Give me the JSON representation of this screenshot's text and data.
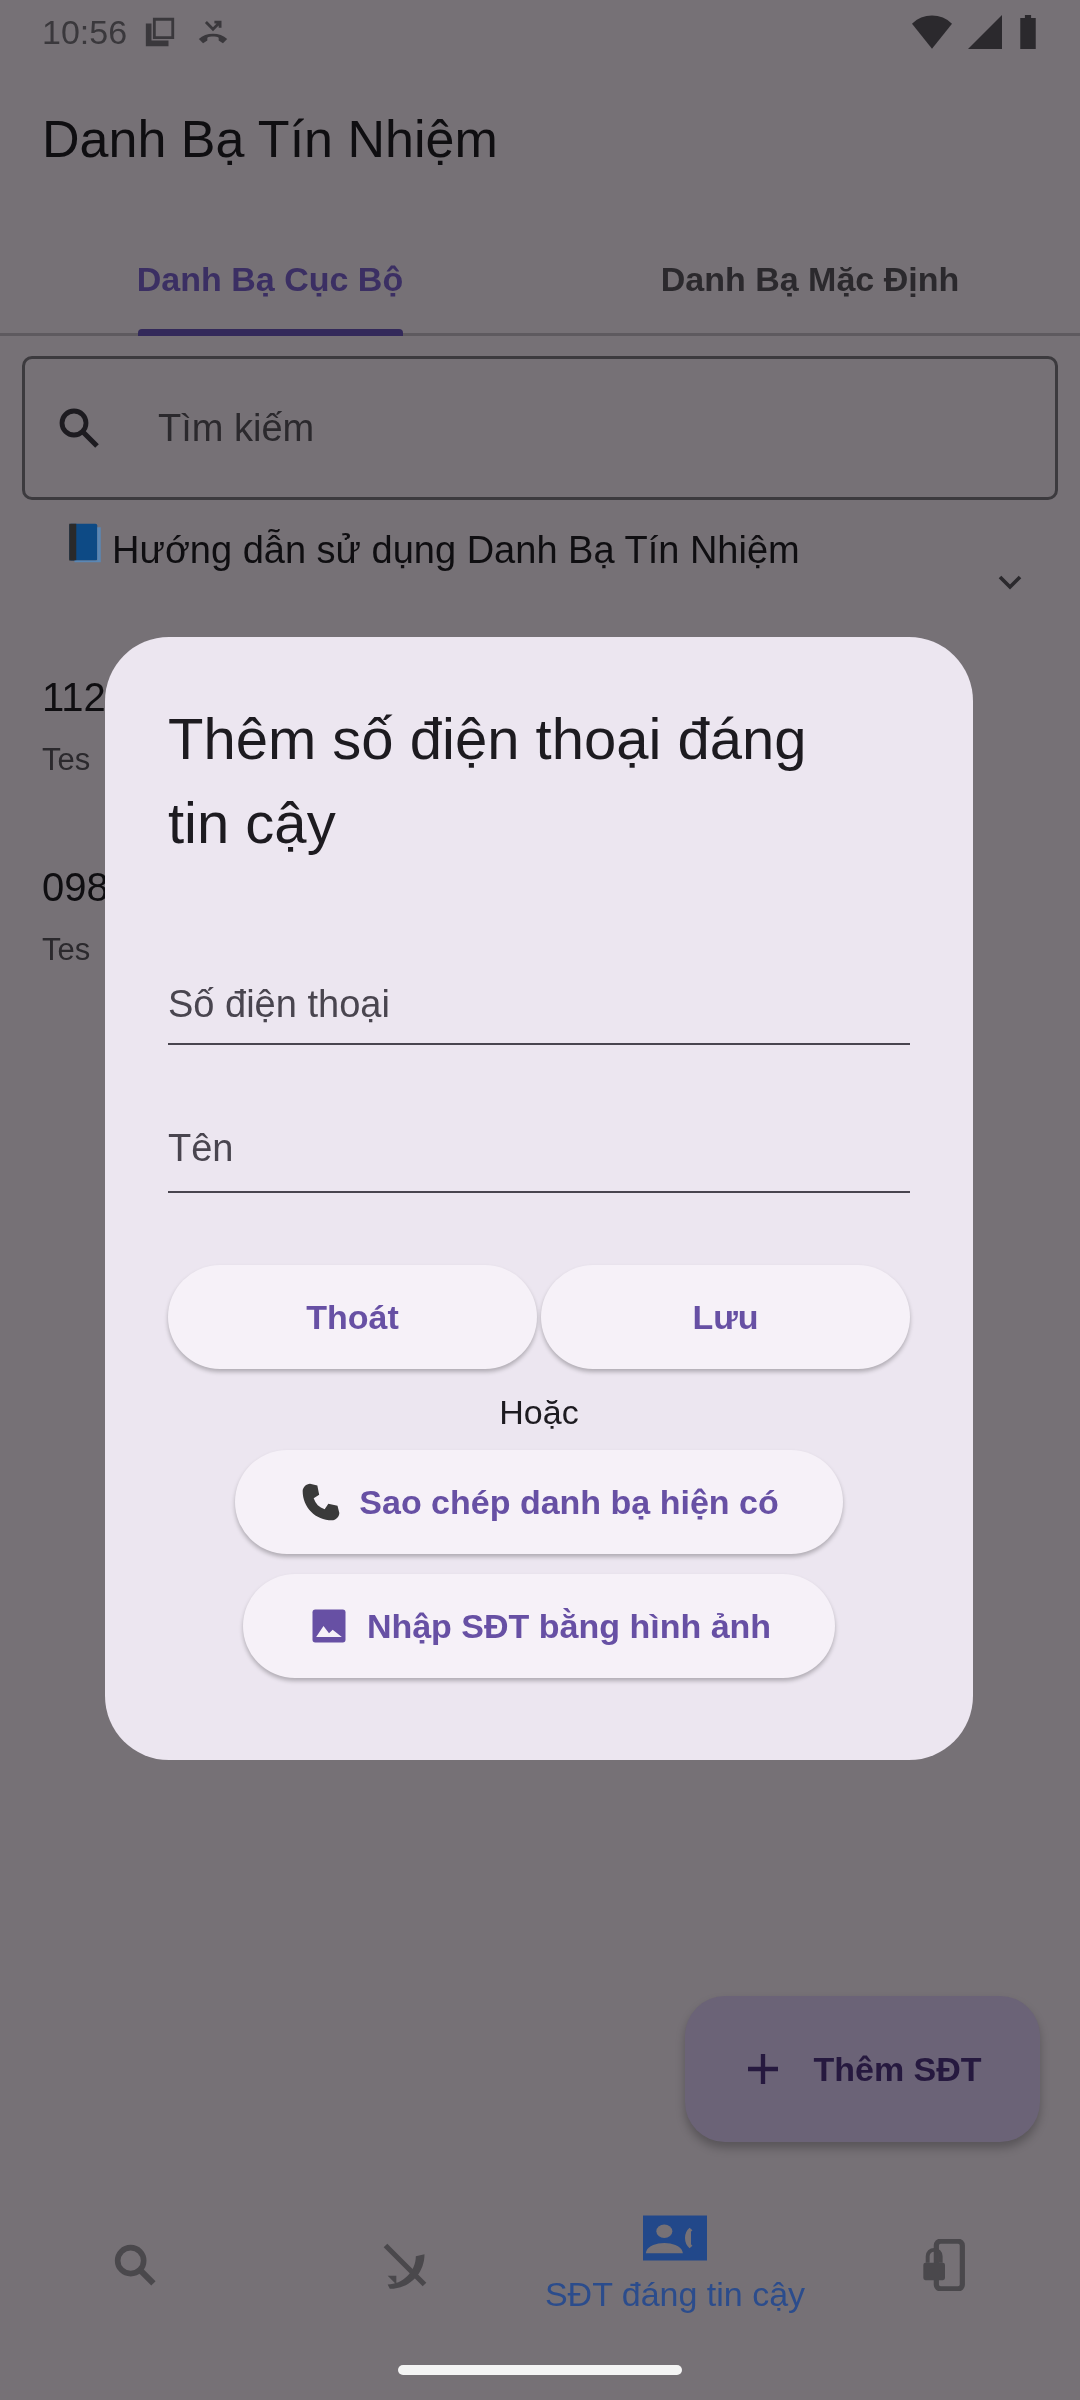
{
  "status_bar": {
    "time": "10:56"
  },
  "app_bar": {
    "title": "Danh Bạ Tín Nhiệm"
  },
  "tabs": [
    {
      "label": "Danh Bạ Cục Bộ",
      "selected": true
    },
    {
      "label": "Danh Bạ Mặc Định",
      "selected": false
    }
  ],
  "search": {
    "placeholder": "Tìm kiếm"
  },
  "guide": {
    "title": "Hướng dẫn sử dụng Danh Bạ Tín Nhiệm",
    "expanded": false
  },
  "contacts": [
    {
      "number": "112",
      "name": "Tes"
    },
    {
      "number": "098",
      "name": "Tes"
    }
  ],
  "dialog": {
    "title": "Thêm số điện thoại đáng tin cậy",
    "fields": [
      {
        "placeholder": "Số điện thoại"
      },
      {
        "placeholder": "Tên"
      }
    ],
    "buttons": [
      "Thoát",
      "Lưu"
    ],
    "separator": "Hoặc",
    "actions": [
      {
        "kind": "phone",
        "label": "Sao chép danh bạ hiện có"
      },
      {
        "kind": "image",
        "label": "Nhập SĐT bằng hình ảnh"
      }
    ]
  },
  "fab": {
    "label": "Thêm SĐT"
  },
  "bottom_nav": [
    {
      "kind": "search",
      "selected": false
    },
    {
      "kind": "blocked",
      "selected": false
    },
    {
      "kind": "trusted",
      "label": "SĐT đáng tin cậy",
      "selected": true
    },
    {
      "kind": "lock",
      "selected": false
    }
  ]
}
